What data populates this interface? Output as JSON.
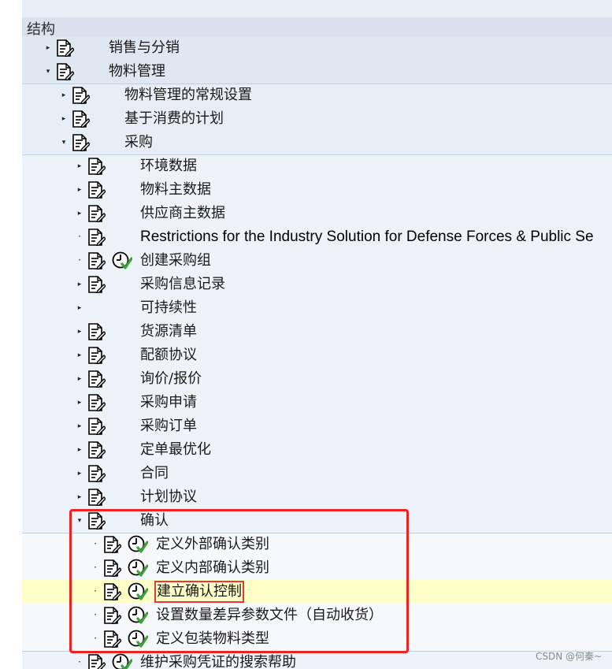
{
  "header": {
    "title": "结构"
  },
  "tree": {
    "items": [
      {
        "label": "销售与分销",
        "icon": "document-pencil-icon",
        "state": "collapsed"
      },
      {
        "label": "物料管理",
        "icon": "document-pencil-icon",
        "state": "expanded"
      },
      {
        "label": "物料管理的常规设置",
        "icon": "document-pencil-icon",
        "state": "collapsed"
      },
      {
        "label": "基于消费的计划",
        "icon": "document-pencil-icon",
        "state": "collapsed"
      },
      {
        "label": "采购",
        "icon": "document-pencil-icon",
        "state": "expanded"
      },
      {
        "label": "环境数据",
        "icon": "document-pencil-icon",
        "state": "collapsed"
      },
      {
        "label": "物料主数据",
        "icon": "document-pencil-icon",
        "state": "collapsed"
      },
      {
        "label": "供应商主数据",
        "icon": "document-pencil-icon",
        "state": "collapsed"
      },
      {
        "label": "Restrictions for the Industry Solution for Defense Forces & Public Se",
        "icon": "document-pencil-icon",
        "state": "leaf"
      },
      {
        "label": "创建采购组",
        "icon": "document-pencil-icon",
        "extra_icon": "clock-check-icon",
        "state": "leaf"
      },
      {
        "label": "采购信息记录",
        "icon": "document-pencil-icon",
        "state": "collapsed"
      },
      {
        "label": "可持续性",
        "icon": "",
        "state": "collapsed"
      },
      {
        "label": "货源清单",
        "icon": "document-pencil-icon",
        "state": "collapsed"
      },
      {
        "label": "配额协议",
        "icon": "document-pencil-icon",
        "state": "collapsed"
      },
      {
        "label": "询价/报价",
        "icon": "document-pencil-icon",
        "state": "collapsed"
      },
      {
        "label": "采购申请",
        "icon": "document-pencil-icon",
        "state": "collapsed"
      },
      {
        "label": "采购订单",
        "icon": "document-pencil-icon",
        "state": "collapsed"
      },
      {
        "label": "定单最优化",
        "icon": "document-pencil-icon",
        "state": "collapsed"
      },
      {
        "label": "合同",
        "icon": "document-pencil-icon",
        "state": "collapsed"
      },
      {
        "label": "计划协议",
        "icon": "document-pencil-icon",
        "state": "collapsed"
      },
      {
        "label": "确认",
        "icon": "document-pencil-icon",
        "state": "expanded"
      },
      {
        "label": "定义外部确认类别",
        "icon": "document-pencil-icon",
        "extra_icon": "clock-check-icon",
        "state": "leaf"
      },
      {
        "label": "定义内部确认类别",
        "icon": "document-pencil-icon",
        "extra_icon": "clock-check-icon",
        "state": "leaf"
      },
      {
        "label": "建立确认控制",
        "icon": "document-pencil-icon",
        "extra_icon": "clock-check-icon",
        "state": "leaf",
        "selected": true
      },
      {
        "label": "设置数量差异参数文件（自动收货）",
        "icon": "document-pencil-icon",
        "extra_icon": "clock-check-icon",
        "state": "leaf"
      },
      {
        "label": "定义包装物料类型",
        "icon": "document-pencil-icon",
        "extra_icon": "clock-check-icon",
        "state": "leaf"
      },
      {
        "label": "维护采购凭证的搜索帮助",
        "icon": "document-pencil-icon",
        "extra_icon": "clock-check-icon",
        "state": "leaf"
      }
    ]
  },
  "colors": {
    "highlight": "#ffffc8",
    "annotation": "#ee2222",
    "check": "#3aa33a"
  },
  "watermark": "CSDN @何秦~"
}
